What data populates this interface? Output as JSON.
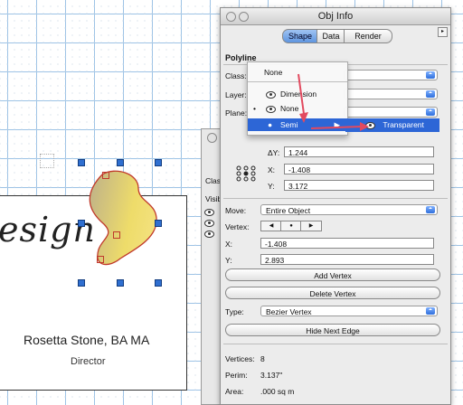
{
  "canvas": {
    "card": {
      "design_text": "esign",
      "name": "Rosetta Stone, BA MA",
      "title": "Director"
    }
  },
  "back_window": {
    "label_class": "Class",
    "label_visib": "Visib"
  },
  "panel": {
    "title": "Obj Info",
    "tabs": [
      "Shape",
      "Data",
      "Render"
    ],
    "selected_tab": "Shape",
    "object_type": "Polyline",
    "class_label": "Class:",
    "layer_label": "Layer:",
    "plane_label": "Plane:",
    "dy_label": "ΔY:",
    "dy_value": "1.244",
    "x_label": "X:",
    "x_value": "-1.408",
    "y_label": "Y:",
    "y_value": "3.172",
    "move_label": "Move:",
    "move_value": "Entire Object",
    "vertex_label": "Vertex:",
    "vx_label": "X:",
    "vx_value": "-1.408",
    "vy_label": "Y:",
    "vy_value": "2.893",
    "add_vertex": "Add Vertex",
    "delete_vertex": "Delete Vertex",
    "type_label": "Type:",
    "type_value": "Bezier Vertex",
    "hide_next_edge": "Hide Next Edge",
    "vertices_label": "Vertices:",
    "vertices_value": "8",
    "perim_label": "Perim:",
    "perim_value": "3.137\"",
    "area_label": "Area:",
    "area_value": ".000 sq m"
  },
  "menu": {
    "items": [
      "None",
      "Dimension",
      "None",
      "Semi"
    ],
    "submenu_item": "Transparent"
  },
  "colors": {
    "accent": "#2d66d6",
    "arrow": "#e24a5f",
    "blob_stroke": "#c0392b"
  }
}
